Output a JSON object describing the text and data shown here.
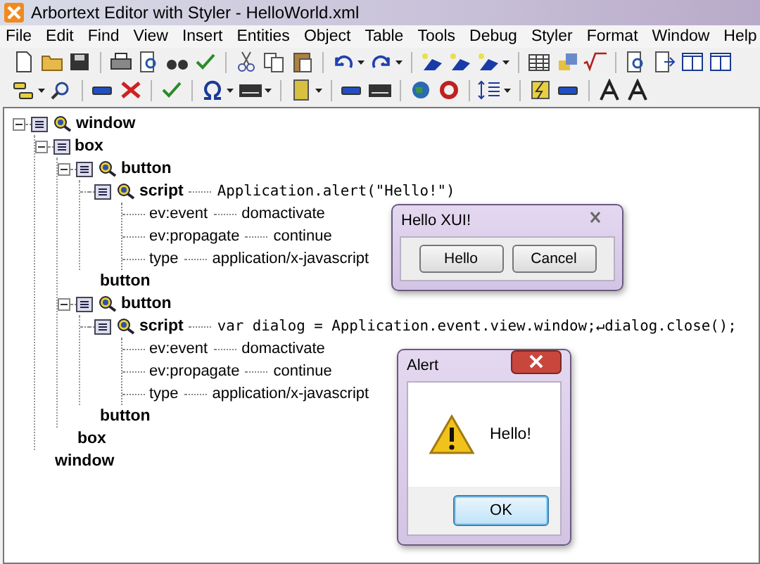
{
  "window": {
    "title": "Arbortext Editor with Styler - HelloWorld.xml"
  },
  "menu": [
    "File",
    "Edit",
    "Find",
    "View",
    "Insert",
    "Entities",
    "Object",
    "Table",
    "Tools",
    "Debug",
    "Styler",
    "Format",
    "Window",
    "Help"
  ],
  "document_tree": [
    {
      "tag": "window",
      "expanded": true,
      "namespace_icon": true,
      "end_tag": "window",
      "children": [
        {
          "tag": "box",
          "expanded": true,
          "namespace_icon": false,
          "end_tag": "box",
          "children": [
            {
              "tag": "button",
              "expanded": true,
              "namespace_icon": true,
              "end_tag": "button",
              "children": [
                {
                  "tag": "script",
                  "namespace_icon": true,
                  "content": "Application.alert(\"Hello!\")",
                  "attributes": [
                    {
                      "name": "ev:event",
                      "value": "domactivate"
                    },
                    {
                      "name": "ev:propagate",
                      "value": "continue"
                    },
                    {
                      "name": "type",
                      "value": "application/x-javascript"
                    }
                  ]
                }
              ]
            },
            {
              "tag": "button",
              "expanded": true,
              "namespace_icon": true,
              "end_tag": "button",
              "children": [
                {
                  "tag": "script",
                  "namespace_icon": true,
                  "content": "var dialog = Application.event.view.window;↵dialog.close();",
                  "attributes": [
                    {
                      "name": "ev:event",
                      "value": "domactivate"
                    },
                    {
                      "name": "ev:propagate",
                      "value": "continue"
                    },
                    {
                      "name": "type",
                      "value": "application/x-javascript"
                    }
                  ]
                }
              ]
            }
          ]
        }
      ]
    }
  ],
  "dialogs": [
    {
      "kind": "form",
      "title": "Hello XUI!",
      "buttons": [
        {
          "label": "Hello",
          "default": false
        },
        {
          "label": "Cancel",
          "default": false
        }
      ]
    },
    {
      "kind": "alert",
      "title": "Alert",
      "message": "Hello!",
      "buttons": [
        {
          "label": "OK",
          "default": true
        }
      ]
    }
  ]
}
